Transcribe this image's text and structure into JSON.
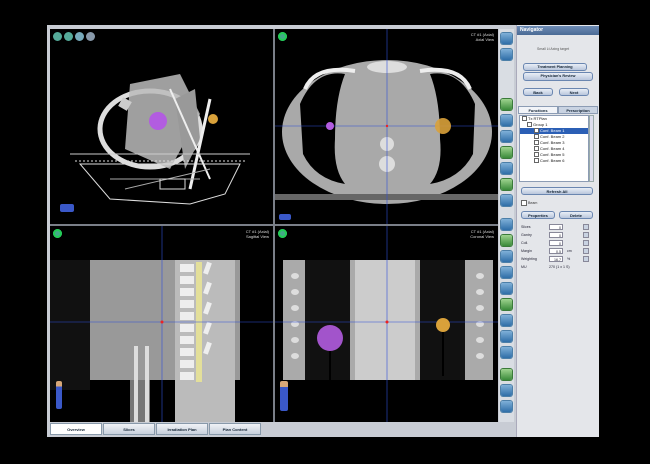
{
  "viewports": {
    "axial": {
      "label": "CT #1 (Axial)\nAxial View"
    },
    "sagittal": {
      "label": "CT #1 (Axial)\nSagittal View"
    },
    "coronal": {
      "label": "CT #1 (Axial)\nCoronal View"
    }
  },
  "panel": {
    "title": "Navigator",
    "subtitle": "Small Lt Axing target",
    "workflow": {
      "step1": "Treatment Planning",
      "step2": "Physician's Review",
      "back": "Back",
      "next": "Next"
    },
    "tabs": [
      "Functions",
      "Prescription"
    ],
    "tree": [
      {
        "label": "Tx RTPlan",
        "indent": 0
      },
      {
        "label": "Group 1",
        "indent": 1
      },
      {
        "label": "Conf. Beam 1",
        "indent": 2,
        "selected": true
      },
      {
        "label": "Conf. Beam 2",
        "indent": 2
      },
      {
        "label": "Conf. Beam 3",
        "indent": 2
      },
      {
        "label": "Conf. Beam 4",
        "indent": 2
      },
      {
        "label": "Conf. Beam 5",
        "indent": 2
      },
      {
        "label": "Conf. Beam 6",
        "indent": 2
      }
    ],
    "refresh": "Refresh All",
    "beam_check": "Beam",
    "properties": "Properties",
    "delete": "Delete",
    "params": [
      {
        "label": "Slices",
        "value": "0",
        "unit": ""
      },
      {
        "label": "Gantry",
        "value": "0",
        "unit": ""
      },
      {
        "label": "Coll.",
        "value": "0",
        "unit": ""
      },
      {
        "label": "Margin",
        "value": "0.5",
        "unit": "cm"
      },
      {
        "label": "Weighting",
        "value": "16.7",
        "unit": "%"
      },
      {
        "label": "MU",
        "value": "",
        "unit": "270 (1 x 1 S)"
      }
    ]
  },
  "bottom_tabs": [
    "Overview",
    "Slices",
    "Irradiation Plan",
    "Plan Content"
  ],
  "colors": {
    "target_left": "#b25ce0",
    "target_right": "#d9a13a",
    "crosshair": "#2f4fd8"
  }
}
